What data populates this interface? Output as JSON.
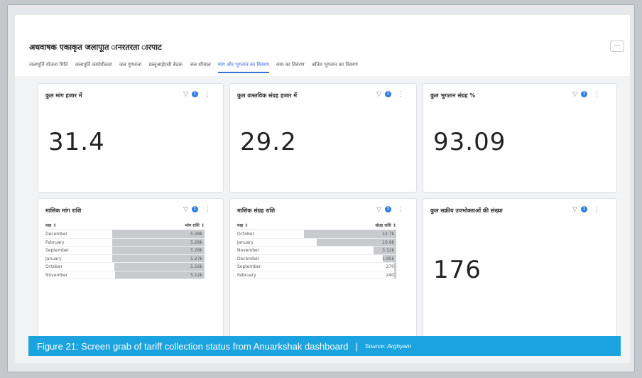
{
  "report_title": "अधवाषक एकाकृत जलापूात ानरतरता ारपाट",
  "more_label": "···",
  "tabs": [
    {
      "label": "जलापूर्ति योजना मिति"
    },
    {
      "label": "जलापूर्ति कार्यशीलता"
    },
    {
      "label": "जल गुणवत्ता"
    },
    {
      "label": "डब्लूआईएसी बैठक"
    },
    {
      "label": "जल शौचाल"
    },
    {
      "label": "मांग और भुगतान का विवरण",
      "active": true
    },
    {
      "label": "व्यय का विवरण"
    },
    {
      "label": "अंतिम भुगतान का विवरण"
    }
  ],
  "filter_icon": "filter-icon",
  "filter_count": "1",
  "cards": {
    "total_demand": {
      "title": "कुल मांग हजार में",
      "value": "31.4"
    },
    "total_collection": {
      "title": "कुल वास्तविक संग्रह हजार में",
      "value": "29.2"
    },
    "payment_pct": {
      "title": "कुल भुगतान संग्रह %",
      "value": "93.09"
    },
    "monthly_demand": {
      "title": "मासिक मांग राशि",
      "col_month": "माह ↕",
      "col_value": "मांग राशि ↕",
      "rows": [
        {
          "month": "December",
          "value": "5.28k",
          "fill": 1.0
        },
        {
          "month": "February",
          "value": "5.28k",
          "fill": 1.0
        },
        {
          "month": "September",
          "value": "5.28k",
          "fill": 1.0
        },
        {
          "month": "January",
          "value": "5.27k",
          "fill": 1.0
        },
        {
          "month": "October",
          "value": "5.16k",
          "fill": 0.98
        },
        {
          "month": "November",
          "value": "5.12k",
          "fill": 0.97
        }
      ]
    },
    "monthly_collection": {
      "title": "मासिक संग्रह राशि",
      "col_month": "माह ↕",
      "col_value": "संग्रह राशि ↕",
      "rows": [
        {
          "month": "October",
          "value": "12.7k",
          "fill": 1.0
        },
        {
          "month": "January",
          "value": "10.9k",
          "fill": 0.86
        },
        {
          "month": "November",
          "value": "3.12k",
          "fill": 0.25
        },
        {
          "month": "December",
          "value": "1.95k",
          "fill": 0.15
        },
        {
          "month": "September",
          "value": "270",
          "fill": 0.02
        },
        {
          "month": "February",
          "value": "240",
          "fill": 0.02
        }
      ]
    },
    "active_consumers": {
      "title": "कुल सक्रीय उपभोक्ताओं की संख्या",
      "value": "176"
    }
  },
  "caption": {
    "text": "Figure 21: Screen grab of tariff collection status from Anuarkshak dashboard",
    "separator": "|",
    "source": "Source: Arghyam"
  }
}
